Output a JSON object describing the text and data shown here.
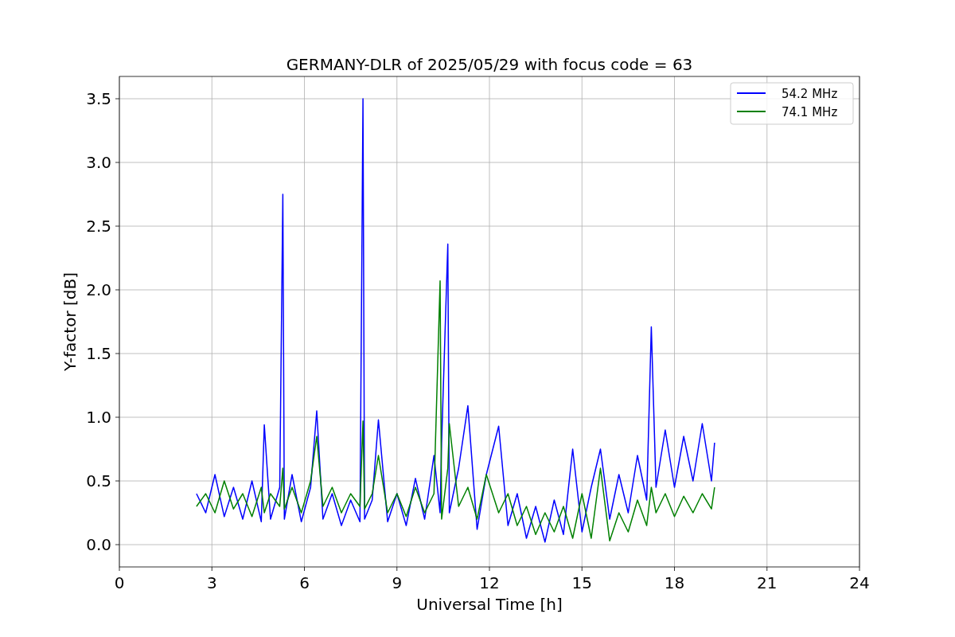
{
  "figure": {
    "chart_data": {
      "type": "line",
      "title": "GERMANY-DLR of 2025/05/29 with focus code = 63",
      "xlabel": "Universal Time [h]",
      "ylabel": "Y-factor [dB]",
      "x": [
        2.5,
        2.8,
        3.1,
        3.4,
        3.7,
        4.0,
        4.3,
        4.6,
        4.7,
        4.9,
        5.2,
        5.3,
        5.35,
        5.6,
        5.9,
        6.2,
        6.4,
        6.6,
        6.9,
        7.2,
        7.5,
        7.8,
        7.9,
        7.95,
        8.2,
        8.4,
        8.7,
        9.0,
        9.3,
        9.6,
        9.9,
        10.2,
        10.4,
        10.45,
        10.65,
        10.7,
        11.0,
        11.3,
        11.6,
        11.9,
        12.3,
        12.6,
        12.9,
        13.2,
        13.5,
        13.8,
        14.1,
        14.4,
        14.7,
        15.0,
        15.3,
        15.6,
        15.9,
        16.2,
        16.5,
        16.8,
        17.1,
        17.25,
        17.4,
        17.7,
        18.0,
        18.3,
        18.6,
        18.9,
        19.2,
        19.3
      ],
      "series": [
        {
          "name": "54.2 MHz",
          "color": "#0000ff",
          "values": [
            0.4,
            0.25,
            0.55,
            0.22,
            0.45,
            0.2,
            0.5,
            0.18,
            0.94,
            0.2,
            0.45,
            2.75,
            0.2,
            0.55,
            0.18,
            0.45,
            1.05,
            0.2,
            0.4,
            0.15,
            0.35,
            0.18,
            3.5,
            0.2,
            0.35,
            0.98,
            0.18,
            0.4,
            0.15,
            0.52,
            0.2,
            0.7,
            0.25,
            0.8,
            2.36,
            0.25,
            0.6,
            1.09,
            0.12,
            0.55,
            0.93,
            0.15,
            0.4,
            0.05,
            0.3,
            0.02,
            0.35,
            0.08,
            0.75,
            0.1,
            0.45,
            0.75,
            0.2,
            0.55,
            0.25,
            0.7,
            0.35,
            1.71,
            0.45,
            0.9,
            0.45,
            0.85,
            0.5,
            0.95,
            0.5,
            0.8
          ]
        },
        {
          "name": "74.1 MHz",
          "color": "#008000",
          "values": [
            0.3,
            0.4,
            0.25,
            0.5,
            0.28,
            0.4,
            0.22,
            0.45,
            0.25,
            0.4,
            0.3,
            0.6,
            0.28,
            0.45,
            0.25,
            0.5,
            0.85,
            0.3,
            0.45,
            0.25,
            0.4,
            0.3,
            0.97,
            0.28,
            0.4,
            0.7,
            0.25,
            0.4,
            0.22,
            0.45,
            0.25,
            0.4,
            2.07,
            0.2,
            0.6,
            0.95,
            0.3,
            0.45,
            0.2,
            0.55,
            0.25,
            0.4,
            0.15,
            0.3,
            0.08,
            0.25,
            0.1,
            0.3,
            0.05,
            0.4,
            0.05,
            0.6,
            0.03,
            0.25,
            0.1,
            0.35,
            0.15,
            0.45,
            0.25,
            0.4,
            0.22,
            0.38,
            0.25,
            0.4,
            0.28,
            0.45
          ]
        }
      ],
      "grid": true,
      "legend": true,
      "xlim": [
        0,
        24
      ],
      "ylim": [
        -0.175,
        3.675
      ],
      "xticks": [
        0,
        3,
        6,
        9,
        12,
        15,
        18,
        21,
        24
      ],
      "yticks": [
        {
          "value": 0,
          "label": "0.0"
        },
        {
          "value": 0.5,
          "label": "0.5"
        },
        {
          "value": 1,
          "label": "1.0"
        },
        {
          "value": 1.5,
          "label": "1.5"
        },
        {
          "value": 2,
          "label": "2.0"
        },
        {
          "value": 2.5,
          "label": "2.5"
        },
        {
          "value": 3,
          "label": "3.0"
        },
        {
          "value": 3.5,
          "label": "3.5"
        }
      ]
    }
  }
}
